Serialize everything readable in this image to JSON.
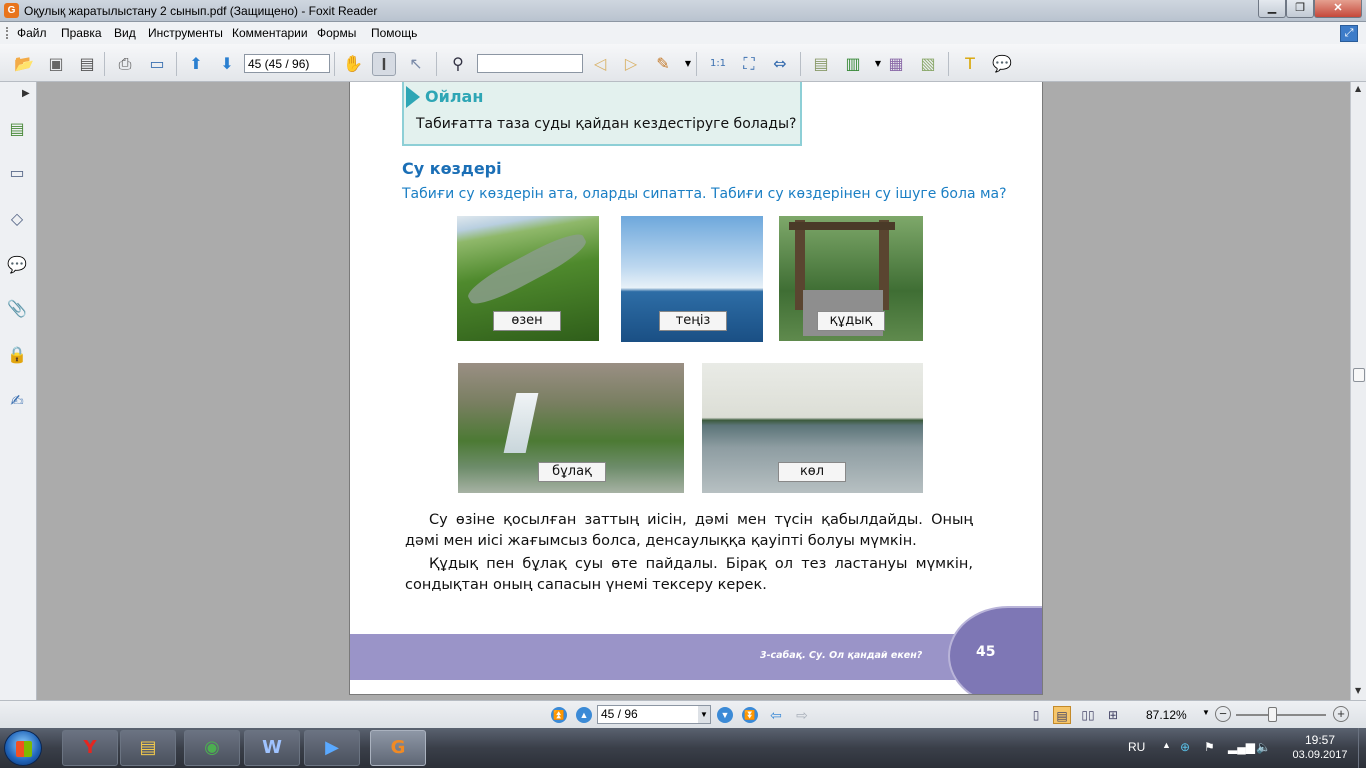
{
  "window": {
    "app_icon": "foxit-icon",
    "title": "Оқулық жаратылыстану 2 сынып.pdf (Защищено) - Foxit Reader"
  },
  "menu": {
    "items": [
      "Файл",
      "Правка",
      "Вид",
      "Инструменты",
      "Комментарии",
      "Формы",
      "Помощь"
    ]
  },
  "toolbar": {
    "page_field": "45 (45 / 96)",
    "search_field": "",
    "icons": [
      "open-icon",
      "save-icon",
      "save-as-icon",
      "print-icon",
      "scan-icon",
      "prev-page-icon",
      "next-page-icon",
      "hand-tool-icon",
      "select-text-icon",
      "select-arrow-icon",
      "find-icon",
      "find-prev-icon",
      "find-next-icon",
      "highlight-icon",
      "actual-size-icon",
      "fit-page-icon",
      "fit-width-icon",
      "create-pdf-icon",
      "export-pdf-icon",
      "pdf-icon",
      "combine-pdf-icon",
      "typewriter-icon",
      "note-icon"
    ]
  },
  "left_panel": {
    "icons": [
      "pages-icon",
      "bookmarks-icon",
      "layers-icon",
      "comments-icon",
      "attachments-icon",
      "security-icon",
      "signature-icon"
    ]
  },
  "document": {
    "think_box": {
      "title": "Ойлан",
      "text": "Табиғатта таза суды қайдан кездестіруге болады?"
    },
    "section_title": "Су көздері",
    "section_subtitle": "Табиғи су көздерін ата, оларды сипатта. Табиғи су көздерінен су ішуге бола ма?",
    "photos": [
      {
        "label": "өзен"
      },
      {
        "label": "теңіз"
      },
      {
        "label": "құдық"
      },
      {
        "label": "бұлақ"
      },
      {
        "label": "көл"
      }
    ],
    "paragraphs": [
      "Су өзіне қосылған заттың иісін, дәмі мен түсін қабылдайды. Оның дәмі мен иісі жағымсыз болса, денсаулыққа қауіпті болуы мүмкін.",
      "Құдық пен бұлақ суы өте пайдалы. Бірақ ол тез ластануы мүмкін, сондықтан оның сапасын үнемі тексеру керек."
    ],
    "footer_text": "3-сабақ. Су. Ол қандай екен?",
    "page_number": "45"
  },
  "statusbar": {
    "page_field": "45 / 96",
    "zoom": "87.12%"
  },
  "taskbar": {
    "apps": [
      {
        "name": "yandex-browser",
        "glyph": "Y",
        "color": "#e52620"
      },
      {
        "name": "file-explorer",
        "glyph": "▤",
        "color": "#f2c94c"
      },
      {
        "name": "chrome",
        "glyph": "◉",
        "color": "#4caf50"
      },
      {
        "name": "word",
        "glyph": "W",
        "color": "#2b579a"
      },
      {
        "name": "media-player",
        "glyph": "▶",
        "color": "#5aa9ff"
      },
      {
        "name": "foxit-reader",
        "glyph": "G",
        "color": "#f08a24"
      }
    ],
    "language": "RU",
    "time": "19:57",
    "date": "03.09.2017"
  }
}
